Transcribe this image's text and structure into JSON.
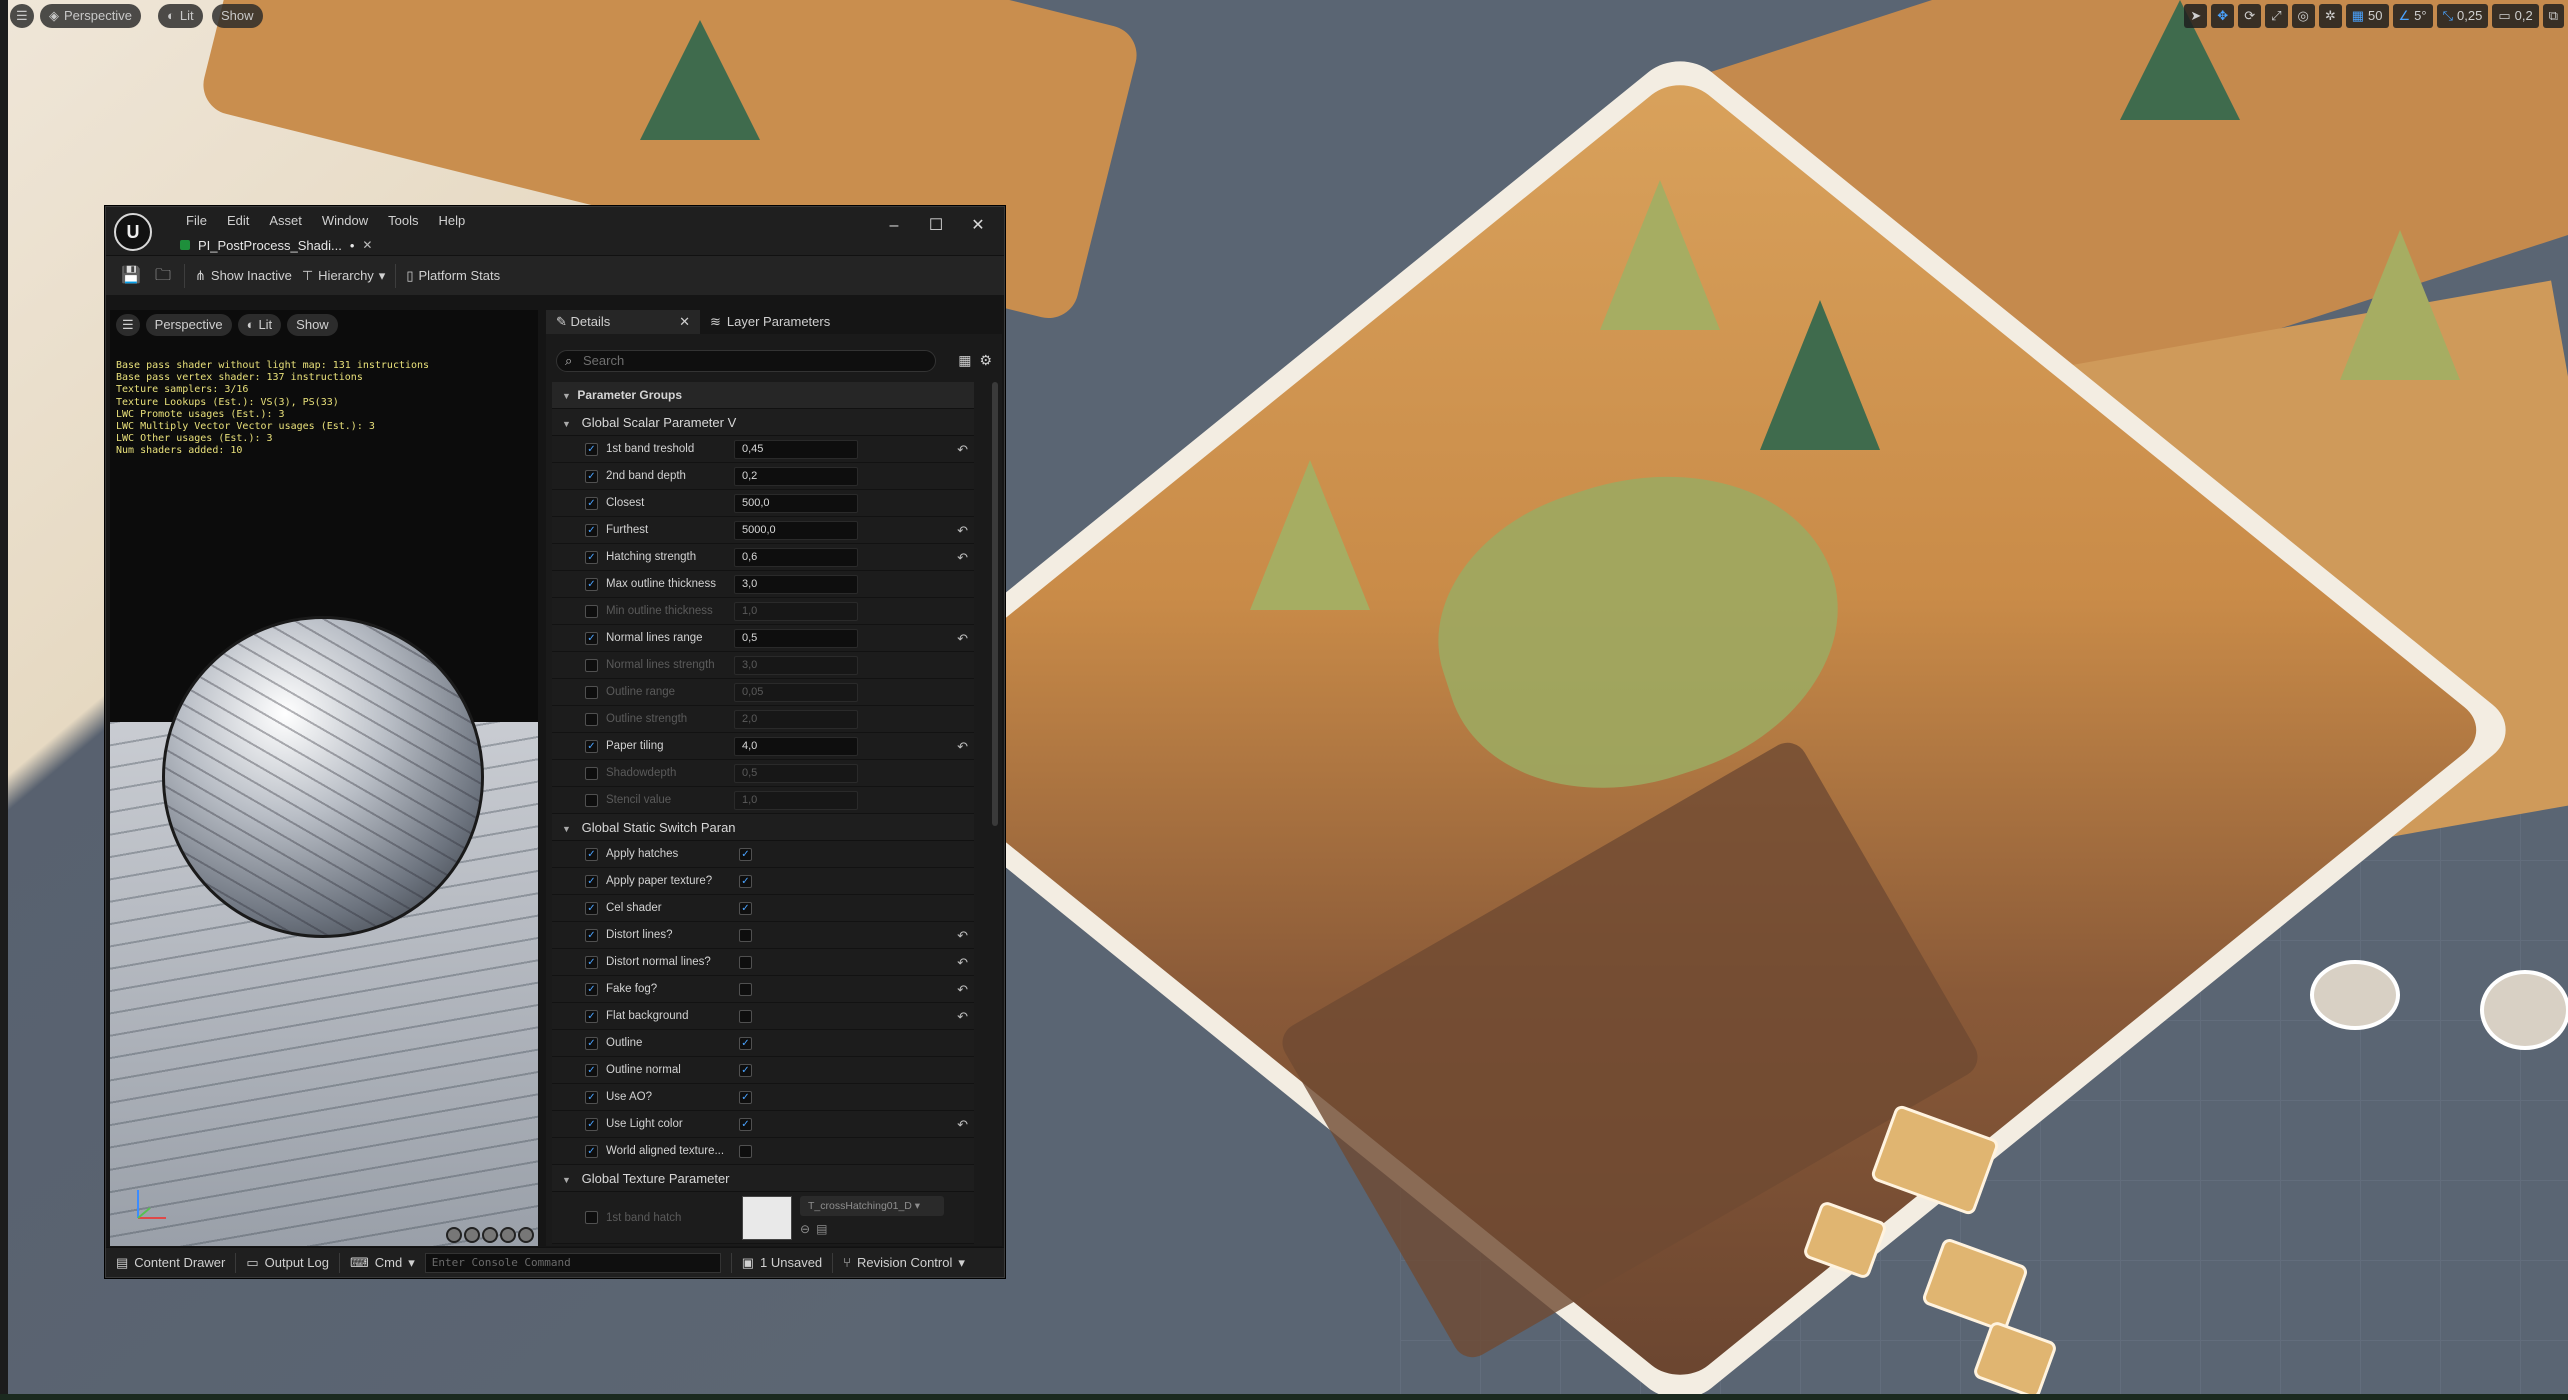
{
  "viewport": {
    "menu_icon": "hamburger-icon",
    "perspective": "Perspective",
    "lit": "Lit",
    "show": "Show",
    "right_toolbar": {
      "grid_snap": "50",
      "angle_snap": "5°",
      "scale_snap": "0,25",
      "camera_speed": "0,2"
    }
  },
  "editor": {
    "menu": [
      "File",
      "Edit",
      "Asset",
      "Window",
      "Tools",
      "Help"
    ],
    "doc_tab": "PI_PostProcess_Shadi...",
    "doc_tab_modified": "•",
    "toolbar": {
      "show_inactive": "Show Inactive",
      "hierarchy": "Hierarchy",
      "platform_stats": "Platform Stats"
    },
    "preview": {
      "perspective": "Perspective",
      "lit": "Lit",
      "show": "Show",
      "stats": [
        "Base pass shader without light map: 131 instructions",
        "Base pass vertex shader: 137 instructions",
        "Texture samplers: 3/16",
        "Texture Lookups (Est.): VS(3), PS(33)",
        "LWC Promote usages (Est.): 3",
        "LWC Multiply Vector Vector usages (Est.): 3",
        "LWC Other usages (Est.): 3",
        "Num shaders added: 10"
      ]
    },
    "details": {
      "tab_details": "Details",
      "tab_layer": "Layer Parameters",
      "search_placeholder": "Search",
      "parameter_groups": "Parameter Groups",
      "scalar_group": "Global Scalar Parameter V",
      "scalars": [
        {
          "label": "1st band treshold",
          "value": "0,45",
          "enabled": true,
          "reset": true
        },
        {
          "label": "2nd band depth",
          "value": "0,2",
          "enabled": true,
          "reset": false
        },
        {
          "label": "Closest",
          "value": "500,0",
          "enabled": true,
          "reset": false
        },
        {
          "label": "Furthest",
          "value": "5000,0",
          "enabled": true,
          "reset": true
        },
        {
          "label": "Hatching strength",
          "value": "0,6",
          "enabled": true,
          "reset": true
        },
        {
          "label": "Max outline thickness",
          "value": "3,0",
          "enabled": true,
          "reset": false
        },
        {
          "label": "Min outline thickness",
          "value": "1,0",
          "enabled": false,
          "reset": false
        },
        {
          "label": "Normal lines range",
          "value": "0,5",
          "enabled": true,
          "reset": true
        },
        {
          "label": "Normal lines strength",
          "value": "3,0",
          "enabled": false,
          "reset": false
        },
        {
          "label": "Outline range",
          "value": "0,05",
          "enabled": false,
          "reset": false
        },
        {
          "label": "Outline strength",
          "value": "2,0",
          "enabled": false,
          "reset": false
        },
        {
          "label": "Paper tiling",
          "value": "4,0",
          "enabled": true,
          "reset": true
        },
        {
          "label": "Shadowdepth",
          "value": "0,5",
          "enabled": false,
          "reset": false
        },
        {
          "label": "Stencil value",
          "value": "1,0",
          "enabled": false,
          "reset": false
        }
      ],
      "switch_group": "Global Static Switch Paran",
      "switches": [
        {
          "label": "Apply hatches",
          "value": true,
          "reset": false
        },
        {
          "label": "Apply paper texture?",
          "value": true,
          "reset": false
        },
        {
          "label": "Cel shader",
          "value": true,
          "reset": false
        },
        {
          "label": "Distort lines?",
          "value": false,
          "reset": true
        },
        {
          "label": "Distort normal lines?",
          "value": false,
          "reset": true
        },
        {
          "label": "Fake fog?",
          "value": false,
          "reset": true
        },
        {
          "label": "Flat background",
          "value": false,
          "reset": true
        },
        {
          "label": "Outline",
          "value": true,
          "reset": false
        },
        {
          "label": "Outline normal",
          "value": true,
          "reset": false
        },
        {
          "label": "Use AO?",
          "value": true,
          "reset": false
        },
        {
          "label": "Use Light color",
          "value": true,
          "reset": true
        },
        {
          "label": "World aligned texture...",
          "value": false,
          "reset": false
        }
      ],
      "texture_group": "Global Texture Parameter",
      "texture": {
        "label": "1st band hatch",
        "asset": "T_crossHatching01_D"
      }
    },
    "statusbar": {
      "content_drawer": "Content Drawer",
      "output_log": "Output Log",
      "cmd": "Cmd",
      "console_placeholder": "Enter Console Command",
      "unsaved": "1 Unsaved",
      "revision_control": "Revision Control"
    }
  },
  "colors": {
    "accent": "#4aa3ff",
    "panel": "#1a1a1a",
    "stats_text": "#e8e07a"
  }
}
